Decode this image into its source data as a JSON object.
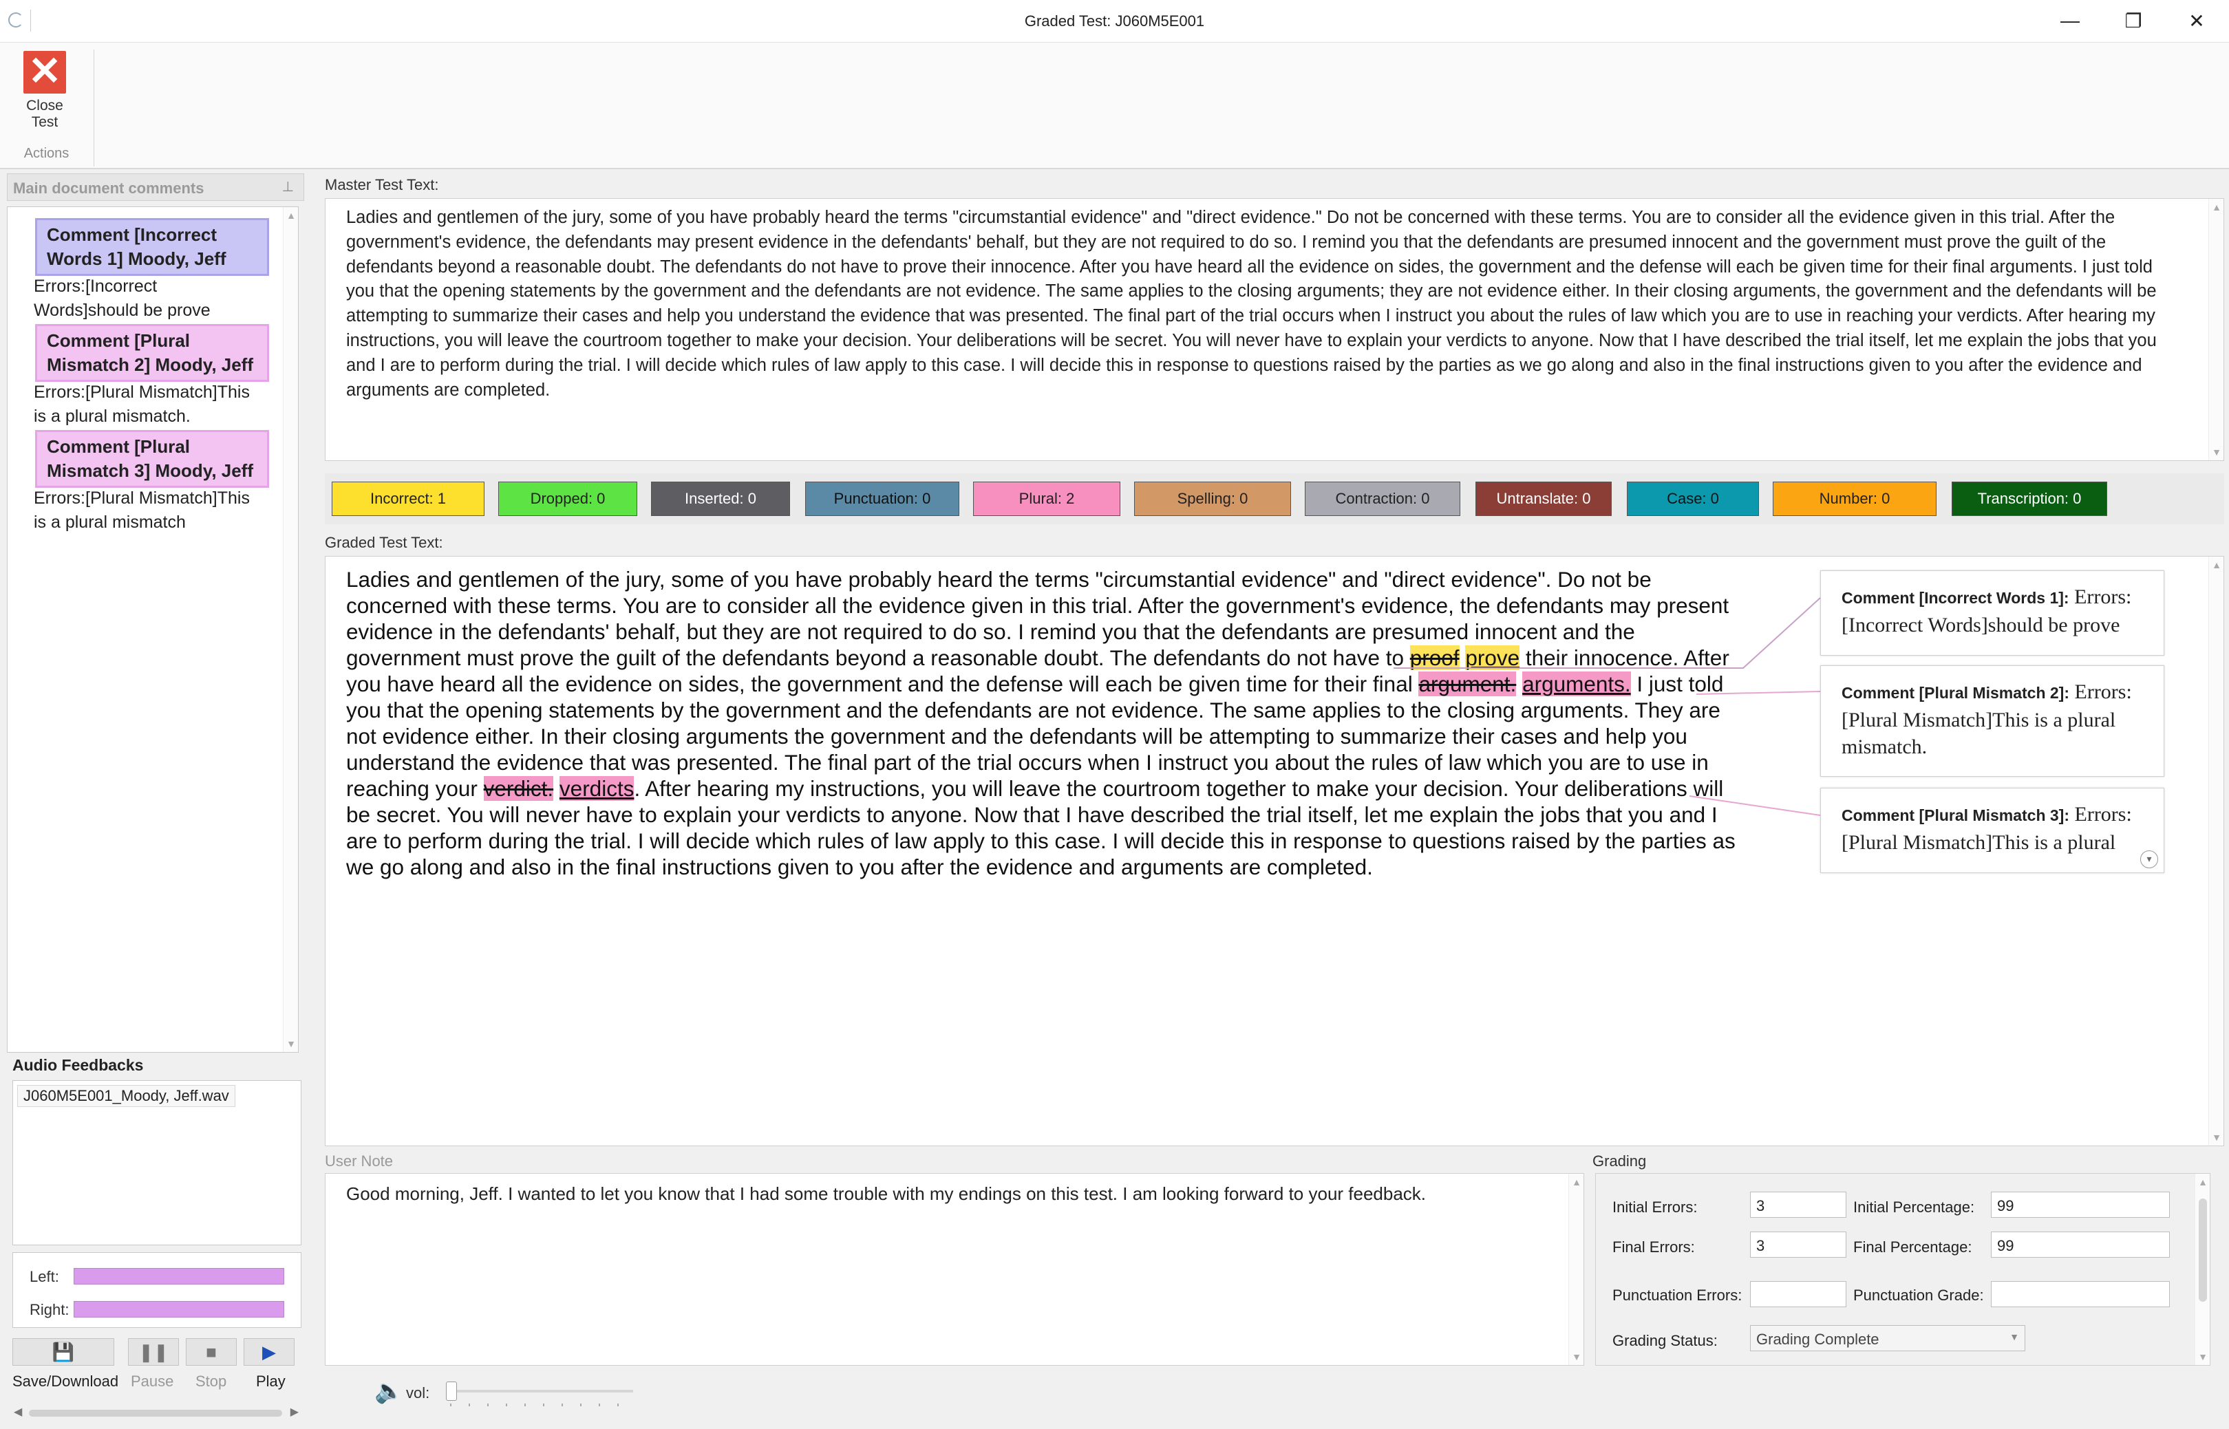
{
  "window": {
    "title": "Graded Test: J060M5E001",
    "minimize": "—",
    "maximize": "❐",
    "close": "✕"
  },
  "ribbon": {
    "close_test_line1": "Close",
    "close_test_line2": "Test",
    "group_label": "Actions"
  },
  "comments_panel": {
    "header": "Main document comments",
    "pin": "⊥",
    "items": [
      {
        "title_line1": "Comment [Incorrect",
        "title_line2": "Words 1]      Moody, Jeff",
        "text_line1": "Errors:[Incorrect",
        "text_line2": "Words]should be prove",
        "color": "#c9c6f5"
      },
      {
        "title_line1": "Comment [Plural",
        "title_line2": "Mismatch 2] Moody, Jeff",
        "text_line1": "Errors:[Plural Mismatch]This",
        "text_line2": "is a plural mismatch.",
        "color": "#f3c3f2"
      },
      {
        "title_line1": "Comment [Plural",
        "title_line2": "Mismatch 3] Moody, Jeff",
        "text_line1": "Errors:[Plural Mismatch]This",
        "text_line2": "is a plural mismatch",
        "color": "#f3c3f2"
      }
    ]
  },
  "audio": {
    "header": "Audio Feedbacks",
    "file": "J060M5E001_Moody, Jeff.wav",
    "left_label": "Left:",
    "right_label": "Right:",
    "save_label": "Save/Download",
    "pause_label": "Pause",
    "stop_label": "Stop",
    "play_label": "Play",
    "vol_label": "vol:"
  },
  "master": {
    "label": "Master Test Text:",
    "text": "Ladies and gentlemen of the jury, some of you have probably heard the terms \"circumstantial evidence\" and \"direct evidence.\" Do not be concerned with these terms. You are to consider all the evidence given in this trial. After the government's evidence, the defendants may present evidence in the defendants' behalf, but they are not required to do so. I remind you that the defendants are presumed innocent and the government must prove the guilt of the defendants beyond a reasonable doubt. The defendants do not have to prove their innocence. After you have heard all the evidence on sides, the government and the defense will each be given time for their final arguments. I just told you that the opening statements by the government and the defendants are not evidence. The same applies to the closing arguments; they are not evidence either. In their closing arguments, the government and the defendants will be attempting to summarize their cases and help you understand the evidence that was presented. The final part of the trial occurs when I instruct you about the rules of law which you are to use in reaching your verdicts. After hearing my instructions, you will leave the courtroom together to make your decision. Your deliberations will be secret. You will never have to explain your verdicts to anyone. Now that I have described the trial itself, let me explain the jobs that you and I are to perform during the trial. I will decide which rules of law apply to this case. I will decide this in response to questions raised by the parties as we go along and also in the final instructions given to you after the evidence and arguments are completed."
  },
  "error_counts": [
    {
      "label": "Incorrect: 1",
      "bg": "#fde02e",
      "fg": "#222"
    },
    {
      "label": "Dropped: 0",
      "bg": "#5ee345",
      "fg": "#222"
    },
    {
      "label": "Inserted: 0",
      "bg": "#5d5d62",
      "fg": "#ffffff"
    },
    {
      "label": "Punctuation: 0",
      "bg": "#5b8aa6",
      "fg": "#111"
    },
    {
      "label": "Plural: 2",
      "bg": "#f78fbf",
      "fg": "#222"
    },
    {
      "label": "Spelling: 0",
      "bg": "#d29866",
      "fg": "#222"
    },
    {
      "label": "Contraction: 0",
      "bg": "#a9a9b1",
      "fg": "#222"
    },
    {
      "label": "Untranslate: 0",
      "bg": "#8b3e36",
      "fg": "#ffffff"
    },
    {
      "label": "Case: 0",
      "bg": "#0c99ad",
      "fg": "#111"
    },
    {
      "label": "Number: 0",
      "bg": "#fca513",
      "fg": "#222"
    },
    {
      "label": "Transcription: 0",
      "bg": "#0a5e12",
      "fg": "#ffffff"
    }
  ],
  "graded": {
    "label": "Graded Test Text:",
    "p1": "Ladies and gentlemen of the jury, some of you have probably heard the terms \"circumstantial evidence\" and \"direct evidence\". Do not be concerned with these terms. You are to consider all the evidence given in this trial. After the government's evidence, the defendants may present evidence in the defendants' behalf, but they are not required to do so. I remind you that the defendants are presumed innocent and the government must prove the guilt of the defendants beyond a reasonable doubt. The defendants do not have to ",
    "err1_old": "proof",
    "err1_new": "prove",
    "p2": " their innocence. After you have heard all the evidence on sides, the government and the defense will each be given time for their final ",
    "err2_old": "argument.",
    "err2_new": "arguments.",
    "p3": " I just told you that the opening statements by the government and the defendants are not evidence. The same applies to the closing arguments. They are not evidence either. In their closing arguments the government and the defendants will be attempting to summarize their cases and help you understand the evidence that was presented. The final part of the trial occurs when I instruct you about the rules of law which you are to use in reaching your ",
    "err3_old": "verdict.",
    "err3_new": "verdicts",
    "p4": ". After hearing my instructions, you will leave the courtroom together to make your decision. Your deliberations will be secret. You will never have to explain your verdicts to anyone. Now that I have described the trial itself, let me explain the jobs that you and I are to perform during the trial. I will decide which rules of law apply to this case. I will decide this in response to questions raised by the parties as we go along and also in the final instructions given to you after the evidence and arguments are completed.",
    "bubbles": [
      {
        "title": "Comment [Incorrect Words 1]:",
        "text": " Errors: [Incorrect Words]should be prove"
      },
      {
        "title": "Comment [Plural Mismatch 2]:",
        "text": " Errors: [Plural Mismatch]This is a plural mismatch."
      },
      {
        "title": "Comment [Plural Mismatch 3]:",
        "text": " Errors: [Plural Mismatch]This is a plural"
      }
    ]
  },
  "user_note": {
    "label": "User Note",
    "text": "Good morning, Jeff.  I wanted to let you know that I had some trouble with my endings on this test. I am looking forward to your feedback."
  },
  "grading": {
    "label": "Grading",
    "initial_errors_label": "Initial Errors:",
    "initial_errors": "3",
    "initial_pct_label": "Initial Percentage:",
    "initial_pct": "99",
    "final_errors_label": "Final Errors:",
    "final_errors": "3",
    "final_pct_label": "Final Percentage:",
    "final_pct": "99",
    "punct_errors_label": "Punctuation Errors:",
    "punct_errors": "",
    "punct_grade_label": "Punctuation Grade:",
    "punct_grade": "",
    "status_label": "Grading Status:",
    "status": "Grading Complete"
  }
}
